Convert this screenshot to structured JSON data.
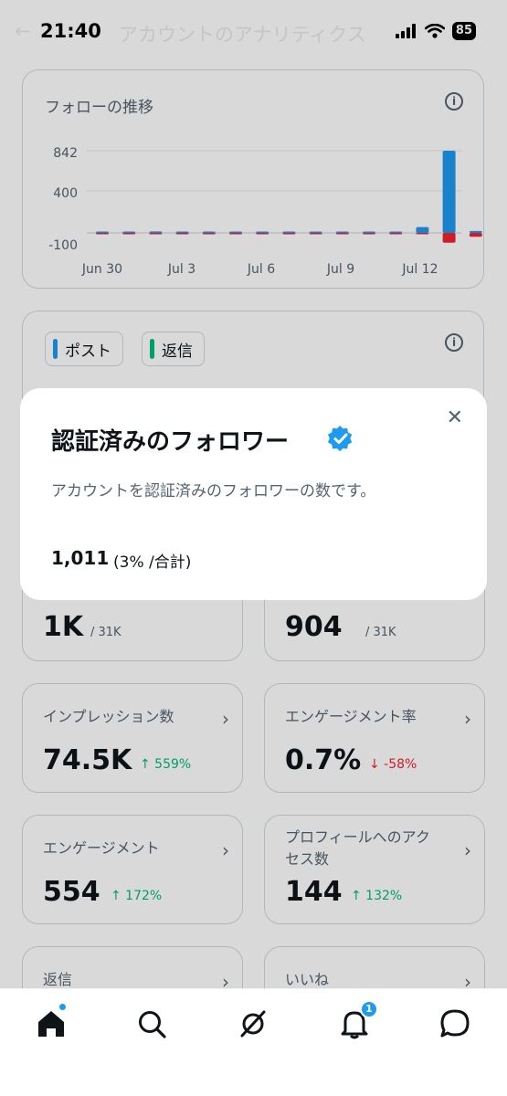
{
  "status_bar": {
    "time": "21:40",
    "battery": "85"
  },
  "header": {
    "title": "アカウントのアナリティクス"
  },
  "follower_chart": {
    "title": "フォローの推移",
    "y_ticks": [
      "842",
      "400",
      "-100"
    ],
    "x_ticks": [
      "Jun 30",
      "Jul 3",
      "Jul 6",
      "Jul 9",
      "Jul 12"
    ]
  },
  "chart_data": {
    "type": "bar",
    "title": "フォローの推移",
    "y_ticks": [
      842,
      400,
      -100
    ],
    "x_ticks": [
      "Jun 30",
      "Jul 3",
      "Jul 6",
      "Jul 9",
      "Jul 12"
    ],
    "ylim": [
      -100,
      842
    ],
    "series": [
      {
        "values": [
          5,
          5,
          15,
          5,
          0,
          0,
          0,
          0,
          0,
          0,
          0,
          10,
          60,
          842,
          20
        ]
      },
      {
        "values": [
          -5,
          -5,
          -5,
          -5,
          -5,
          -5,
          -5,
          -5,
          -5,
          -5,
          -5,
          -5,
          -10,
          -100,
          -40
        ]
      }
    ],
    "colors": [
      "#1d9bf0",
      "#f4212e"
    ]
  },
  "legend_card": {
    "tags": [
      {
        "label": "ポスト",
        "color": "#1d9bf0"
      },
      {
        "label": "返信",
        "color": "#00ba7c"
      }
    ]
  },
  "metrics": {
    "row1": [
      {
        "value": "1K",
        "total": "/ 31K"
      },
      {
        "value": "904",
        "total": "/ 31K"
      }
    ],
    "impressions": {
      "label": "インプレッション数",
      "value": "74.5K",
      "change": "↑ 559%"
    },
    "engagement_rate": {
      "label": "エンゲージメント率",
      "value": "0.7%",
      "change": "↓ -58%"
    },
    "engagements": {
      "label": "エンゲージメント",
      "value": "554",
      "change": "↑ 172%"
    },
    "profile_visits": {
      "label_line1": "プロフィールへのアク",
      "label_line2": "セス数",
      "value": "144",
      "change": "↑ 132%"
    },
    "replies": {
      "label": "返信"
    },
    "likes": {
      "label": "いいね"
    }
  },
  "modal": {
    "title": "認証済みのフォロワー",
    "description": "アカウントを認証済みのフォロワーの数です。",
    "value": "1,011",
    "percent": "(3% /合計)"
  },
  "tabbar": {
    "notifications_count": "1"
  }
}
